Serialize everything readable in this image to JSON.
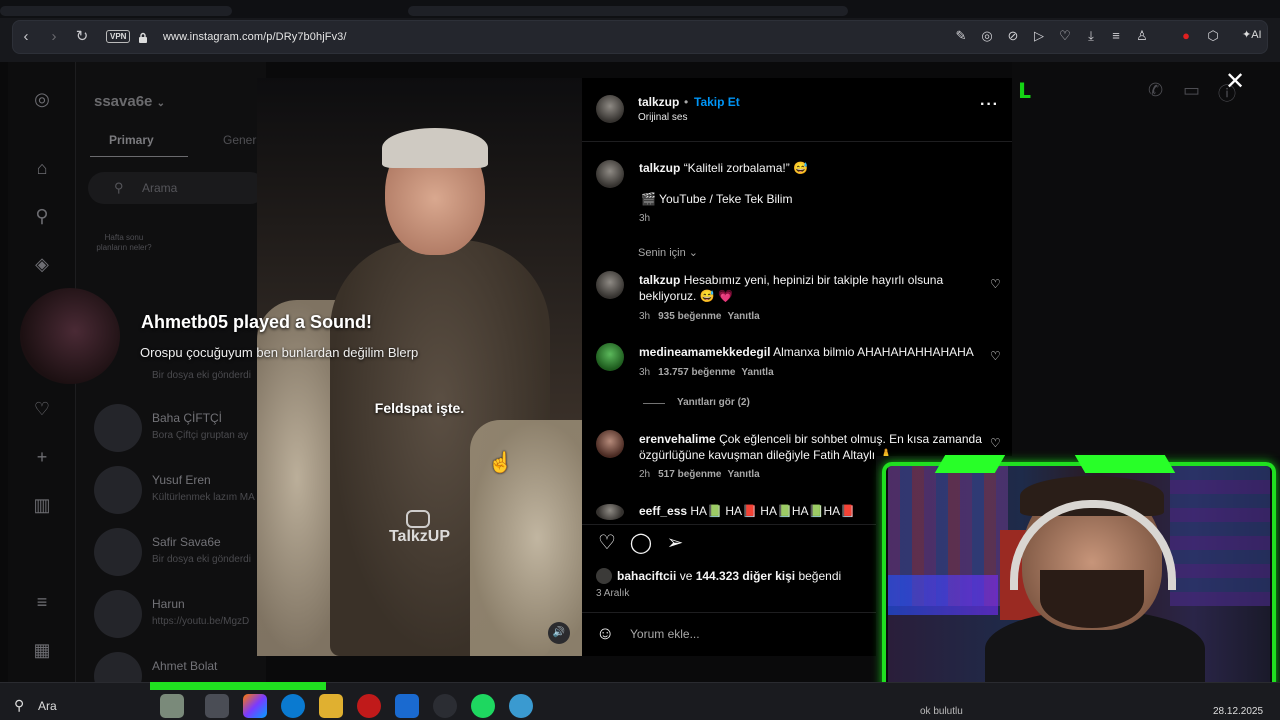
{
  "browser": {
    "url": "www.instagram.com/p/DRy7b0hjFv3/",
    "vpn_label": "VPN",
    "ai_label": "AI"
  },
  "instagram_bg": {
    "account": "ssava6e",
    "tabs": [
      "Primary",
      "General"
    ],
    "search_placeholder": "Arama",
    "weekend_note": "Hafta sonu planların neler?",
    "dm_rows": [
      {
        "name": "",
        "message": "Bir dosya eki gönderdi"
      },
      {
        "name": "Baha ÇİFTÇİ",
        "message": "Bora Çiftçi gruptan ay"
      },
      {
        "name": "Yusuf Eren",
        "message": "Kültürlenmek lazım MA"
      },
      {
        "name": "Safir Sava6e",
        "message": "Bir dosya eki gönderdi"
      },
      {
        "name": "Harun",
        "message": "https://youtu.be/MgzD"
      },
      {
        "name": "Ahmet Bolat",
        "message": ""
      }
    ]
  },
  "alert": {
    "title": "Ahmetb05 played a Sound!",
    "text": "Orospu çocuğuyum ben bunlardan değilim Blerp"
  },
  "video": {
    "caption": "Feldspat işte.",
    "watermark": "TalkzUP"
  },
  "post": {
    "username": "talkzup",
    "separator": "•",
    "follow_label": "Takip Et",
    "audio_label": "Orijinal ses",
    "caption_quote": "“Kaliteli zorbalama!” 😅",
    "caption_source": "🎬 YouTube / Teke Tek Bilim",
    "caption_time": "3h",
    "for_you_label": "Senin için",
    "comments": [
      {
        "user": "talkzup",
        "text": "Hesabımız yeni, hepinizi bir takiple hayırlı olsuna bekliyoruz. 😅 💗",
        "time": "3h",
        "likes": "935 beğenme",
        "reply": "Yanıtla"
      },
      {
        "user": "medineamamekkedegil",
        "text": "Almanxa bilmio AHAHAHAHHAHAHA",
        "time": "3h",
        "likes": "13.757 beğenme",
        "reply": "Yanıtla"
      },
      {
        "user": "erenvehalime",
        "text": "Çok eğlenceli bir sohbet olmuş. En kısa zamanda özgürlüğüne kavuşman dileğiyle Fatih Altaylı 🙏",
        "time": "2h",
        "likes": "517 beğenme",
        "reply": "Yanıtla"
      },
      {
        "user": "eeff_ess",
        "text": "HA📗 HA📕 HA📗HA📗HA📕"
      }
    ],
    "view_replies": "Yanıtları gör (2)",
    "liked_by_user": "bahaciftcii",
    "liked_by_mid": " ve ",
    "liked_by_count": "144.323 diğer kişi",
    "liked_by_suffix": " beğendi",
    "date": "3 Aralık",
    "comment_placeholder": "Yorum ekle..."
  },
  "taskbar": {
    "search_label": "Ara",
    "note": "ok bulutlu",
    "date": "28.12.2025"
  },
  "colors": {
    "follow_blue": "#0095f6",
    "overlay_green": "#20e020",
    "heart_red": "#ff3040"
  },
  "icons": [
    "back-icon",
    "forward-icon",
    "reload-icon",
    "lock-icon",
    "close-icon",
    "heart-icon",
    "comment-icon",
    "share-icon",
    "emoji-icon",
    "volume-icon",
    "search-icon",
    "more-icon"
  ]
}
